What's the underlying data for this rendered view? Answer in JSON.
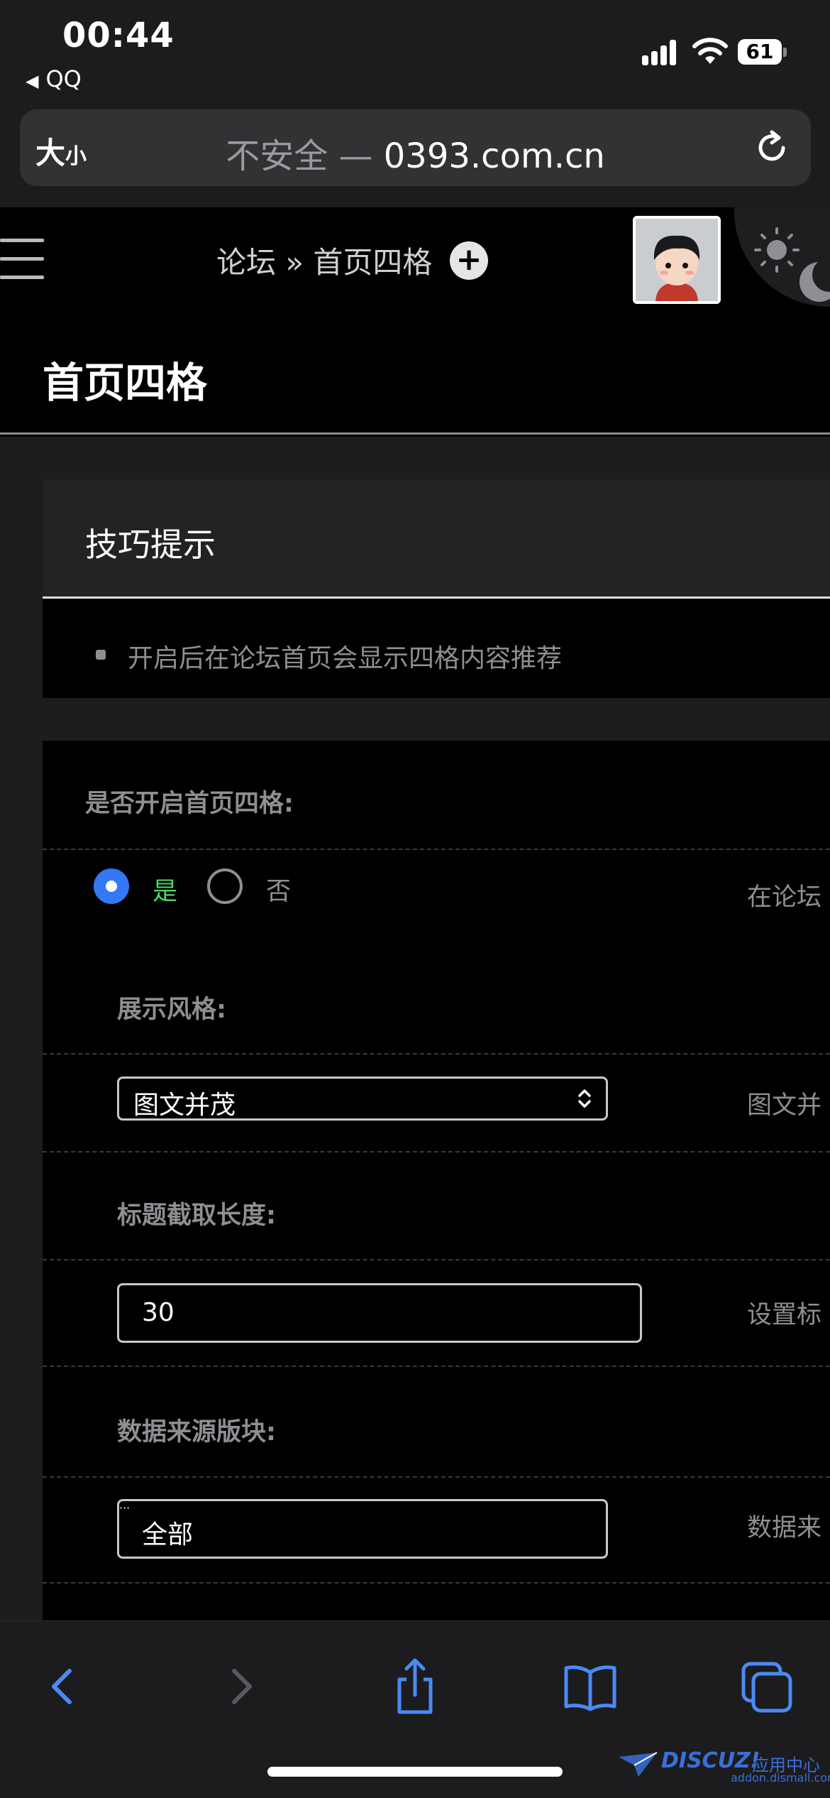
{
  "status_bar": {
    "time": "00:44",
    "back_app": "QQ",
    "battery": "61"
  },
  "browser": {
    "text_size_big": "大",
    "text_size_small": "小",
    "insecure_label": "不安全 — ",
    "domain": "0393.com.cn"
  },
  "header": {
    "breadcrumb": "论坛 » 首页四格",
    "add_button": "+"
  },
  "page": {
    "title": "首页四格"
  },
  "tips": {
    "title": "技巧提示",
    "items": [
      "开启后在论坛首页会显示四格内容推荐"
    ]
  },
  "settings": {
    "enable": {
      "label": "是否开启首页四格:",
      "options": [
        {
          "label": "是",
          "selected": true
        },
        {
          "label": "否",
          "selected": false
        }
      ],
      "help": "在论坛"
    },
    "style": {
      "label": "展示风格:",
      "value": "图文并茂",
      "help": "图文并"
    },
    "title_length": {
      "label": "标题截取长度:",
      "value": "30",
      "help": "设置标"
    },
    "source_forum": {
      "label": "数据来源版块:",
      "value": "全部",
      "help": "数据来"
    }
  },
  "colors": {
    "accent_blue": "#3478f6",
    "selected_green": "#4cd964",
    "muted_gray": "#8e8e93"
  },
  "watermark": {
    "brand": "DISCUZ!",
    "brand_cn": "应用中心",
    "url": "addon.dismall.com"
  }
}
